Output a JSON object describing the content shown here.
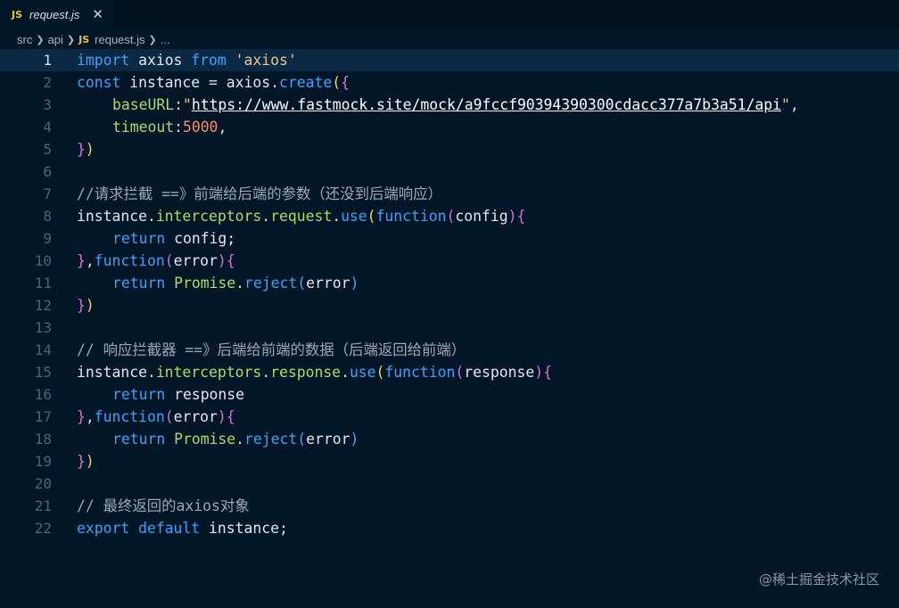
{
  "tab": {
    "badge": "JS",
    "filename": "request.js",
    "close_glyph": "✕"
  },
  "breadcrumb": {
    "items": [
      "src",
      "api",
      "request.js",
      "..."
    ],
    "file_badge": "JS"
  },
  "editor": {
    "active_line": 1,
    "line_numbers": [
      "1",
      "2",
      "3",
      "4",
      "5",
      "6",
      "7",
      "8",
      "9",
      "10",
      "11",
      "12",
      "13",
      "14",
      "15",
      "16",
      "17",
      "18",
      "19",
      "20",
      "21",
      "22"
    ],
    "code": {
      "l1_import": "import",
      "l1_axios": " axios ",
      "l1_from": "from",
      "l1_str": " 'axios'",
      "l2_const": "const",
      "l2_instance": " instance ",
      "l2_eq": "= ",
      "l2_axios": "axios",
      "l2_dot": ".",
      "l2_create": "create",
      "l2_paren": "(",
      "l2_brace": "{",
      "l3_key": "baseURL",
      "l3_colon": ":",
      "l3_q1": "\"",
      "l3_url": "https://www.fastmock.site/mock/a9fccf90394390300cdacc377a7b3a51/api",
      "l3_q2": "\"",
      "l3_comma": ",",
      "l4_key": "timeout",
      "l4_colon": ":",
      "l4_num": "5000",
      "l4_comma": ",",
      "l5_brace": "}",
      "l5_paren": ")",
      "l7_comment": "//请求拦截 ==》前端给后端的参数（还没到后端响应）",
      "l8_instance": "instance.",
      "l8_interceptors": "interceptors",
      "l8_dot1": ".",
      "l8_request": "request",
      "l8_dot2": ".",
      "l8_use": "use",
      "l8_paren": "(",
      "l8_function": "function",
      "l8_p2": "(",
      "l8_config": "config",
      "l8_p3": ")",
      "l8_brace": "{",
      "l9_return": "return",
      "l9_config": " config;",
      "l10_brace": "}",
      "l10_comma": ",",
      "l10_function": "function",
      "l10_p1": "(",
      "l10_error": "error",
      "l10_p2": ")",
      "l10_brace2": "{",
      "l11_return": "return",
      "l11_promise": " Promise",
      "l11_dot": ".",
      "l11_reject": "reject",
      "l11_p1": "(",
      "l11_error": "error",
      "l11_p2": ")",
      "l12_brace": "}",
      "l12_paren": ")",
      "l14_comment": "// 响应拦截器 ==》后端给前端的数据（后端返回给前端）",
      "l15_instance": "instance.",
      "l15_interceptors": "interceptors",
      "l15_dot1": ".",
      "l15_response": "response",
      "l15_dot2": ".",
      "l15_use": "use",
      "l15_paren": "(",
      "l15_function": "function",
      "l15_p2": "(",
      "l15_arg": "response",
      "l15_p3": ")",
      "l15_brace": "{",
      "l16_return": "return",
      "l16_response": " response",
      "l17_brace": "}",
      "l17_comma": ",",
      "l17_function": "function",
      "l17_p1": "(",
      "l17_error": "error",
      "l17_p2": ")",
      "l17_brace2": "{",
      "l18_return": "return",
      "l18_promise": " Promise",
      "l18_dot": ".",
      "l18_reject": "reject",
      "l18_p1": "(",
      "l18_error": "error",
      "l18_p2": ")",
      "l19_brace": "}",
      "l19_paren": ")",
      "l21_comment": "// 最终返回的axios对象",
      "l22_export": "export",
      "l22_default": " default",
      "l22_instance": " instance;"
    }
  },
  "watermark": "@稀土掘金技术社区",
  "colors": {
    "background": "#011627",
    "keyword": "#3ea2ff",
    "string": "#ecc48d",
    "property": "#addb67",
    "number": "#f78c6c",
    "comment": "#9aa9b8",
    "js_badge": "#e8c53c"
  }
}
